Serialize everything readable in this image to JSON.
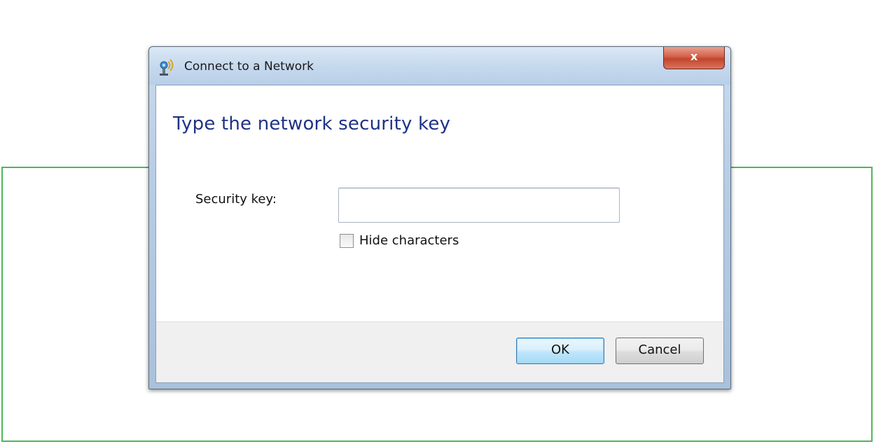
{
  "window": {
    "title": "Connect to a Network",
    "close_label": "x"
  },
  "content": {
    "heading": "Type the network security key",
    "security_key_label": "Security key:",
    "security_key_value": "",
    "hide_characters_label": "Hide characters",
    "hide_characters_checked": false
  },
  "buttons": {
    "ok_label": "OK",
    "cancel_label": "Cancel"
  },
  "icons": {
    "title_icon": "network-icon",
    "close_icon": "close-icon"
  },
  "colors": {
    "heading": "#1e3287",
    "frame": "#4fb65a",
    "close_button": "#c1442b"
  }
}
